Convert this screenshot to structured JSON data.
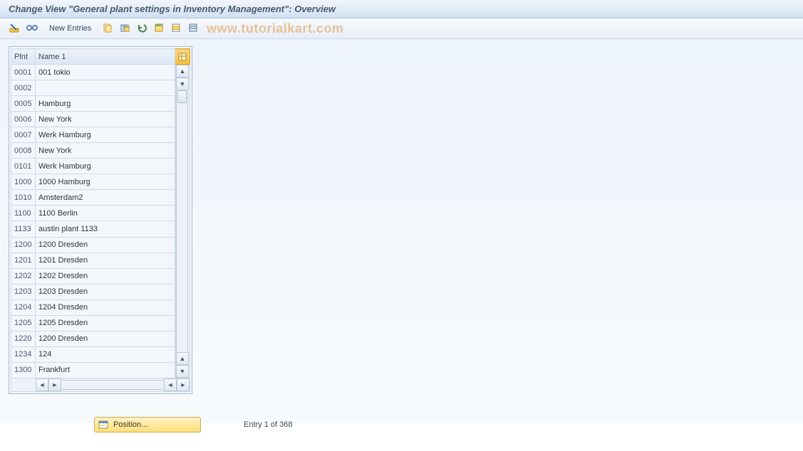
{
  "title": "Change View \"General plant settings in Inventory Management\": Overview",
  "toolbar": {
    "detail_icon": "detail",
    "find_icon": "find",
    "new_entries": "New Entries",
    "copy_icon": "copy",
    "delete_icon": "delete",
    "undo_icon": "undo",
    "select_all_icon": "select-all",
    "select_block_icon": "select-block",
    "deselect_all_icon": "deselect"
  },
  "watermark": "www.tutorialkart.com",
  "grid": {
    "headers": {
      "plnt": "Plnt",
      "name1": "Name 1"
    },
    "rows": [
      {
        "plnt": "0001",
        "name": "001 tokio"
      },
      {
        "plnt": "0002",
        "name": ""
      },
      {
        "plnt": "0005",
        "name": "Hamburg"
      },
      {
        "plnt": "0006",
        "name": "New York"
      },
      {
        "plnt": "0007",
        "name": "Werk Hamburg"
      },
      {
        "plnt": "0008",
        "name": "New York"
      },
      {
        "plnt": "0101",
        "name": "Werk Hamburg"
      },
      {
        "plnt": "1000",
        "name": "1000 Hamburg"
      },
      {
        "plnt": "1010",
        "name": "Amsterdam2"
      },
      {
        "plnt": "1100",
        "name": "1100 Berlin"
      },
      {
        "plnt": "1133",
        "name": "austin plant 1133"
      },
      {
        "plnt": "1200",
        "name": "1200 Dresden"
      },
      {
        "plnt": "1201",
        "name": "1201 Dresden"
      },
      {
        "plnt": "1202",
        "name": "1202 Dresden"
      },
      {
        "plnt": "1203",
        "name": "1203 Dresden"
      },
      {
        "plnt": "1204",
        "name": "1204 Dresden"
      },
      {
        "plnt": "1205",
        "name": "1205 Dresden"
      },
      {
        "plnt": "1220",
        "name": "1200 Dresden"
      },
      {
        "plnt": "1234",
        "name": "124"
      },
      {
        "plnt": "1300",
        "name": "Frankfurt"
      }
    ]
  },
  "footer": {
    "position_label": "Position...",
    "entry_text": "Entry 1 of 368"
  }
}
